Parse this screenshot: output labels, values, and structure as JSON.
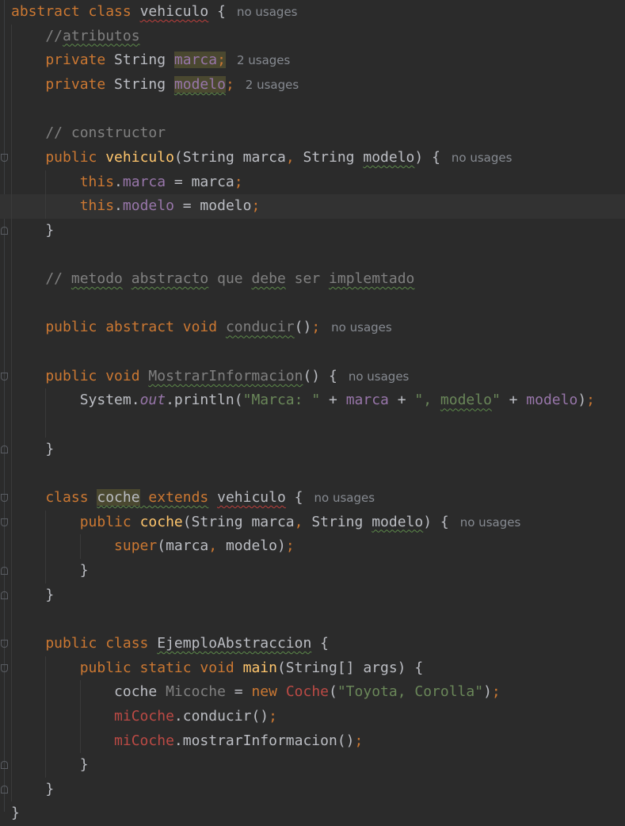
{
  "editor": {
    "current_line": 8,
    "colors": {
      "background": "#2b2b2b",
      "keyword": "#cc7832",
      "field": "#9876aa",
      "string": "#6a8759",
      "comment": "#808080",
      "method": "#ffc66d",
      "error": "#bc4a45"
    },
    "fold_lines": [
      6,
      9,
      15,
      18,
      20,
      21,
      23,
      24,
      26,
      27,
      31,
      32
    ],
    "lines": [
      [
        [
          "kw",
          "abstract class "
        ],
        [
          "id wr",
          "vehiculo"
        ],
        [
          "id",
          " {"
        ],
        [
          "hint",
          "no usages"
        ]
      ],
      [
        [
          "cmt",
          "    //"
        ],
        [
          "cmt wg",
          "atributos"
        ]
      ],
      [
        [
          "kw",
          "    private "
        ],
        [
          "id",
          "String "
        ],
        [
          "field hl",
          "marca"
        ],
        [
          "p hl",
          ";"
        ],
        [
          "hint",
          "2 usages"
        ]
      ],
      [
        [
          "kw",
          "    private "
        ],
        [
          "id",
          "String "
        ],
        [
          "field hl wg",
          "modelo"
        ],
        [
          "p",
          ";"
        ],
        [
          "hint",
          "2 usages"
        ]
      ],
      [],
      [
        [
          "cmt",
          "    // constructor"
        ]
      ],
      [
        [
          "kw",
          "    public "
        ],
        [
          "fn",
          "vehiculo"
        ],
        [
          "id",
          "(String marca"
        ],
        [
          "p",
          ", "
        ],
        [
          "id",
          "String "
        ],
        [
          "id wg",
          "modelo"
        ],
        [
          "id",
          ") {"
        ],
        [
          "hint",
          "no usages"
        ]
      ],
      [
        [
          "kw",
          "        this"
        ],
        [
          "id",
          "."
        ],
        [
          "field",
          "marca"
        ],
        [
          "id",
          " = marca"
        ],
        [
          "p",
          ";"
        ]
      ],
      [
        [
          "kw",
          "        this"
        ],
        [
          "id",
          "."
        ],
        [
          "field",
          "modelo"
        ],
        [
          "id",
          " = modelo"
        ],
        [
          "p",
          ";"
        ]
      ],
      [
        [
          "id",
          "    }"
        ]
      ],
      [],
      [
        [
          "cmt",
          "    // "
        ],
        [
          "cmt wg",
          "metodo"
        ],
        [
          "cmt",
          " "
        ],
        [
          "cmt wg",
          "abstracto"
        ],
        [
          "cmt",
          " que "
        ],
        [
          "cmt wg",
          "debe"
        ],
        [
          "cmt",
          " ser "
        ],
        [
          "cmt wg",
          "implemtado"
        ]
      ],
      [],
      [
        [
          "kw",
          "    public abstract void "
        ],
        [
          "unused wg",
          "conducir"
        ],
        [
          "id",
          "()"
        ],
        [
          "p",
          ";"
        ],
        [
          "hint",
          "no usages"
        ]
      ],
      [],
      [
        [
          "kw",
          "    public void "
        ],
        [
          "unused wg",
          "MostrarInformacion"
        ],
        [
          "id",
          "() {"
        ],
        [
          "hint",
          "no usages"
        ]
      ],
      [
        [
          "id",
          "        System."
        ],
        [
          "static",
          "out"
        ],
        [
          "id",
          ".println("
        ],
        [
          "str",
          "\"Marca: \""
        ],
        [
          "id",
          " + "
        ],
        [
          "field",
          "marca"
        ],
        [
          "id",
          " + "
        ],
        [
          "str",
          "\", "
        ],
        [
          "str wg",
          "modelo"
        ],
        [
          "str",
          "\""
        ],
        [
          "id",
          " + "
        ],
        [
          "field",
          "modelo"
        ],
        [
          "id",
          ")"
        ],
        [
          "p",
          ";"
        ]
      ],
      [],
      [
        [
          "id",
          "    }"
        ]
      ],
      [],
      [
        [
          "kw",
          "    class "
        ],
        [
          "id hl wg",
          "coche"
        ],
        [
          "kw wg",
          " extends"
        ],
        [
          "id",
          " "
        ],
        [
          "id wr",
          "vehiculo"
        ],
        [
          "id",
          " {"
        ],
        [
          "hint",
          "no usages"
        ]
      ],
      [
        [
          "kw",
          "        public "
        ],
        [
          "fn",
          "coche"
        ],
        [
          "id",
          "(String marca"
        ],
        [
          "p",
          ", "
        ],
        [
          "id",
          "String "
        ],
        [
          "id wg",
          "modelo"
        ],
        [
          "id",
          ") {"
        ],
        [
          "hint",
          "no usages"
        ]
      ],
      [
        [
          "kw",
          "            super"
        ],
        [
          "id",
          "(marca"
        ],
        [
          "p",
          ", "
        ],
        [
          "id",
          "modelo)"
        ],
        [
          "p",
          ";"
        ]
      ],
      [
        [
          "id",
          "        }"
        ]
      ],
      [
        [
          "id",
          "    }"
        ]
      ],
      [],
      [
        [
          "kw",
          "    public class "
        ],
        [
          "id wg",
          "EjemploAbstraccion"
        ],
        [
          "id",
          " {"
        ]
      ],
      [
        [
          "kw",
          "        public static void "
        ],
        [
          "fn",
          "main"
        ],
        [
          "id",
          "(String[] args) {"
        ]
      ],
      [
        [
          "id",
          "            coche "
        ],
        [
          "unused",
          "Micoche"
        ],
        [
          "id",
          " = "
        ],
        [
          "kw",
          "new "
        ],
        [
          "err",
          "Coche"
        ],
        [
          "id",
          "("
        ],
        [
          "str",
          "\"Toyota, Corolla\""
        ],
        [
          "id",
          ")"
        ],
        [
          "p",
          ";"
        ]
      ],
      [
        [
          "err",
          "            miCoche"
        ],
        [
          "id",
          ".conducir()"
        ],
        [
          "p",
          ";"
        ]
      ],
      [
        [
          "err",
          "            miCoche"
        ],
        [
          "id",
          ".mostrarInformacion()"
        ],
        [
          "p",
          ";"
        ]
      ],
      [
        [
          "id",
          "        }"
        ]
      ],
      [
        [
          "id",
          "    }"
        ]
      ],
      [
        [
          "id",
          "}"
        ]
      ]
    ]
  }
}
